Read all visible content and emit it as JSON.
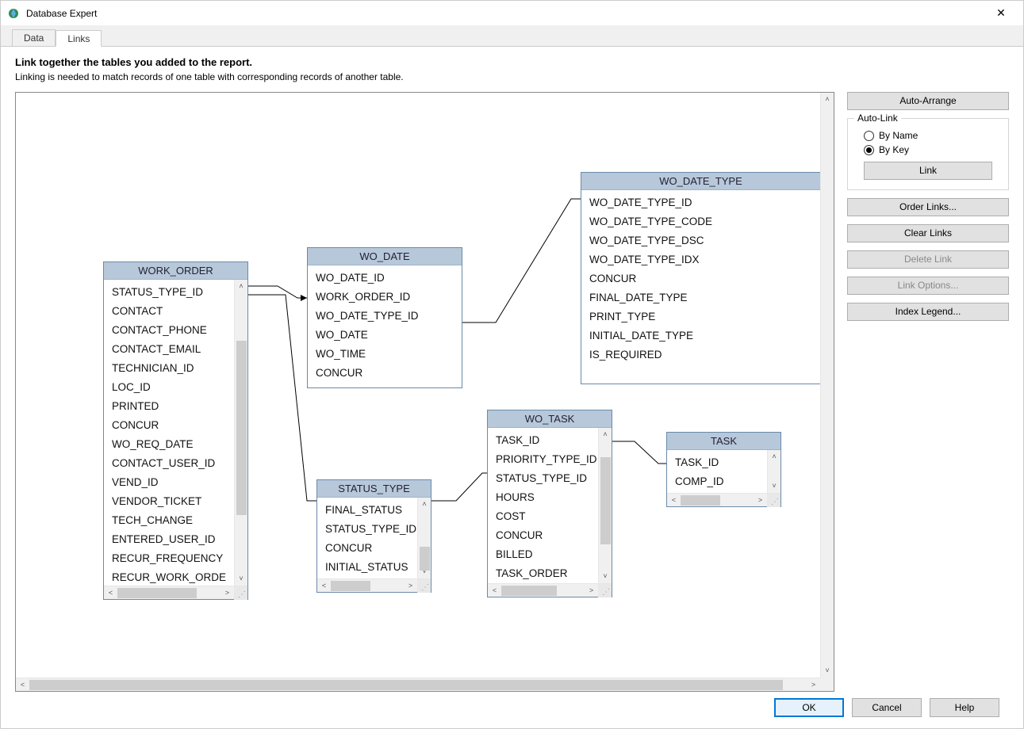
{
  "window": {
    "title": "Database Expert"
  },
  "tabs": {
    "data": "Data",
    "links": "Links"
  },
  "header": {
    "heading": "Link together the tables you added to the report.",
    "subheading": "Linking is needed to match records of one table with corresponding records of another table."
  },
  "side": {
    "auto_arrange": "Auto-Arrange",
    "auto_link_legend": "Auto-Link",
    "by_name": "By Name",
    "by_key": "By Key",
    "link": "Link",
    "order_links": "Order Links...",
    "clear_links": "Clear Links",
    "delete_link": "Delete Link",
    "link_options": "Link Options...",
    "index_legend": "Index Legend..."
  },
  "footer": {
    "ok": "OK",
    "cancel": "Cancel",
    "help": "Help"
  },
  "tables": {
    "work_order": {
      "title": "WORK_ORDER",
      "fields": [
        "STATUS_TYPE_ID",
        "CONTACT",
        "CONTACT_PHONE",
        "CONTACT_EMAIL",
        "TECHNICIAN_ID",
        "LOC_ID",
        "PRINTED",
        "CONCUR",
        "WO_REQ_DATE",
        "CONTACT_USER_ID",
        "VEND_ID",
        "VENDOR_TICKET",
        "TECH_CHANGE",
        "ENTERED_USER_ID",
        "RECUR_FREQUENCY",
        "RECUR_WORK_ORDE"
      ]
    },
    "wo_date": {
      "title": "WO_DATE",
      "fields": [
        "WO_DATE_ID",
        "WORK_ORDER_ID",
        "WO_DATE_TYPE_ID",
        "WO_DATE",
        "WO_TIME",
        "CONCUR"
      ]
    },
    "wo_date_type": {
      "title": "WO_DATE_TYPE",
      "fields": [
        "WO_DATE_TYPE_ID",
        "WO_DATE_TYPE_CODE",
        "WO_DATE_TYPE_DSC",
        "WO_DATE_TYPE_IDX",
        "CONCUR",
        "FINAL_DATE_TYPE",
        "PRINT_TYPE",
        "INITIAL_DATE_TYPE",
        "IS_REQUIRED"
      ]
    },
    "status_type": {
      "title": "STATUS_TYPE",
      "fields": [
        "FINAL_STATUS",
        "STATUS_TYPE_ID",
        "CONCUR",
        "INITIAL_STATUS"
      ]
    },
    "wo_task": {
      "title": "WO_TASK",
      "fields": [
        "TASK_ID",
        "PRIORITY_TYPE_ID",
        "STATUS_TYPE_ID",
        "HOURS",
        "COST",
        "CONCUR",
        "BILLED",
        "TASK_ORDER"
      ]
    },
    "task": {
      "title": "TASK",
      "fields": [
        "TASK_ID",
        "COMP_ID"
      ]
    }
  }
}
